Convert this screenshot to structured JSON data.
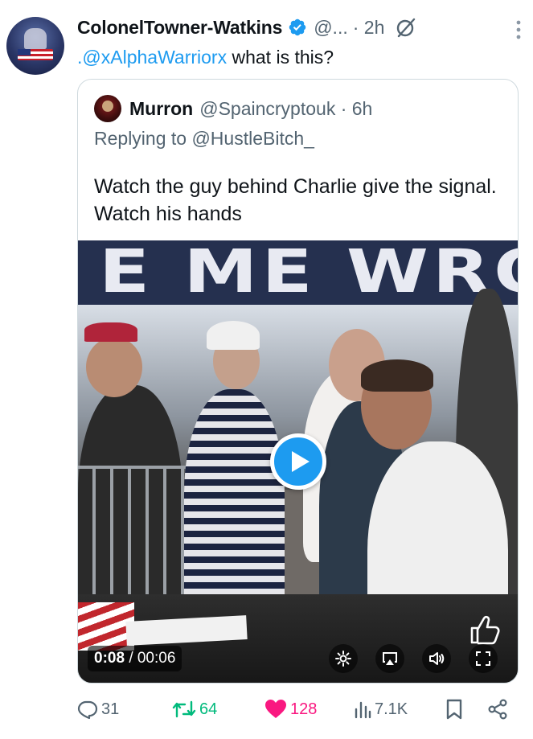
{
  "post": {
    "author_name": "ColonelTowner-Watkins",
    "handle": "@...",
    "time": "· 2h",
    "mention": ".@xAlphaWarriorx",
    "text": " what is this?"
  },
  "quoted_post": {
    "author_name": "Murron",
    "handle": "@Spaincryptouk · 6h",
    "replying_to": "Replying to @HustleBitch_",
    "text": "Watch the guy behind Charlie give the signal. Watch his hands"
  },
  "video": {
    "banner_text": "E ME WRONG",
    "current_time": "0:08",
    "duration": "/ 00:06"
  },
  "actions": {
    "replies": "31",
    "reposts": "64",
    "likes": "128",
    "views": "7.1K"
  },
  "colors": {
    "accent": "#1d9bf0",
    "repost": "#00ba7c",
    "like": "#f91880",
    "muted": "#536471"
  },
  "icons": [
    "verified-badge-icon",
    "grok-icon",
    "more-icon",
    "play-icon",
    "settings-icon",
    "airplay-icon",
    "volume-icon",
    "fullscreen-icon",
    "thumbs-up-icon",
    "reply-icon",
    "repost-icon",
    "like-icon",
    "views-icon",
    "bookmark-icon",
    "share-icon"
  ]
}
